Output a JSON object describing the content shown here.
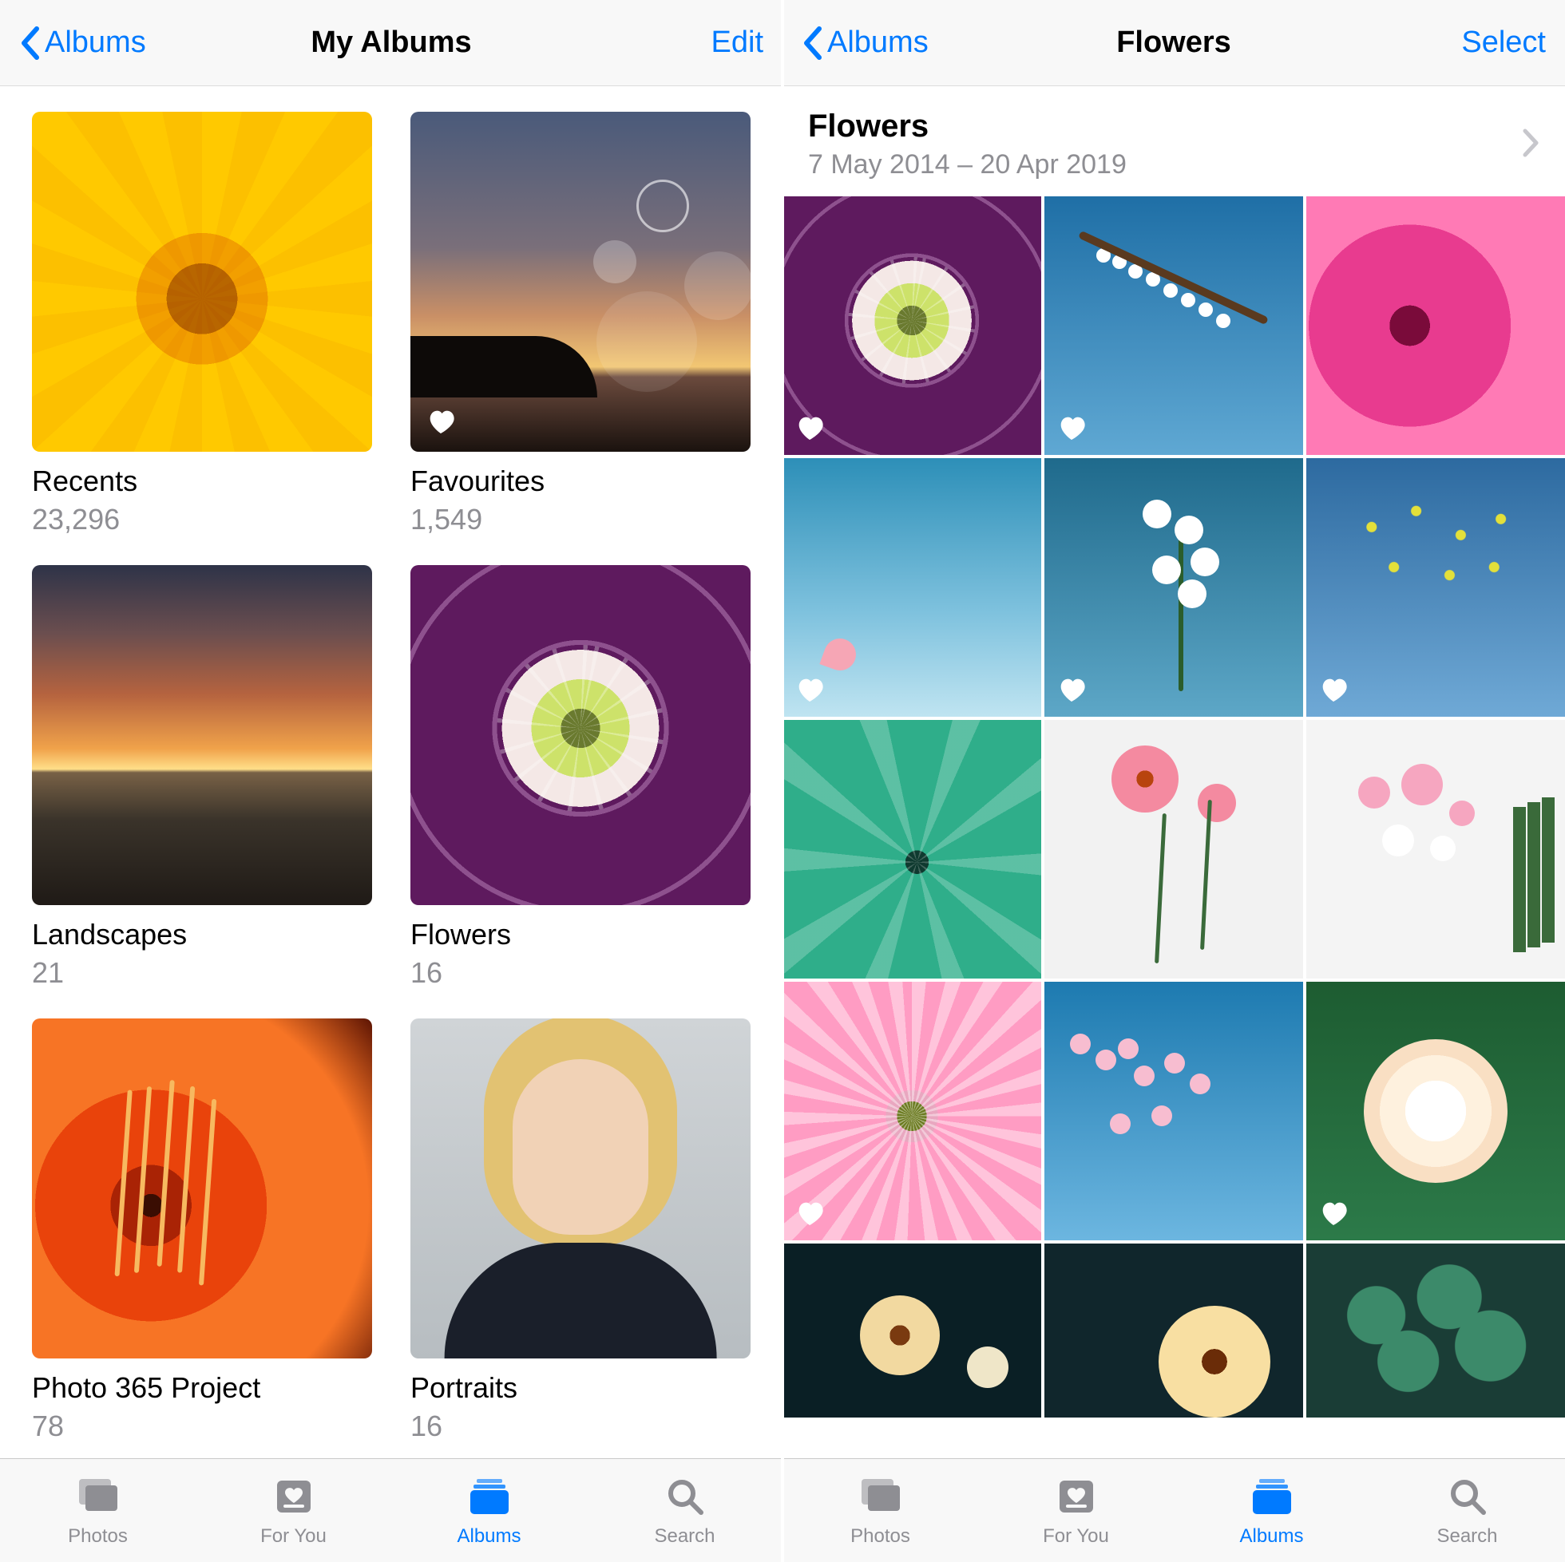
{
  "left": {
    "nav": {
      "back": "Albums",
      "title": "My Albums",
      "action": "Edit"
    },
    "albums": [
      {
        "name": "Recents",
        "count": "23,296",
        "art": "art-yellow",
        "favourite": false
      },
      {
        "name": "Favourites",
        "count": "1,549",
        "art": "art-bubbles",
        "favourite": true
      },
      {
        "name": "Landscapes",
        "count": "21",
        "art": "art-sunset",
        "favourite": false
      },
      {
        "name": "Flowers",
        "count": "16",
        "art": "art-hellebore",
        "favourite": false
      },
      {
        "name": "Photo 365 Project",
        "count": "78",
        "art": "art-orange",
        "favourite": false
      },
      {
        "name": "Portraits",
        "count": "16",
        "art": "art-portrait",
        "favourite": false
      }
    ],
    "peek": [
      "art-grey",
      "art-hedge"
    ]
  },
  "right": {
    "nav": {
      "back": "Albums",
      "title": "Flowers",
      "action": "Select"
    },
    "header": {
      "title": "Flowers",
      "subtitle": "7 May 2014 – 20 Apr 2019"
    },
    "photos": [
      {
        "art": "art-hellebore",
        "favourite": true
      },
      {
        "art": "p-blossom",
        "favourite": true
      },
      {
        "art": "p-pinkclose",
        "favourite": false
      },
      {
        "art": "p-skyblossom",
        "favourite": true
      },
      {
        "art": "p-orchid",
        "favourite": true
      },
      {
        "art": "p-yellowtiny",
        "favourite": true
      },
      {
        "art": "p-succulent",
        "favourite": false
      },
      {
        "art": "p-gerbera",
        "favourite": false
      },
      {
        "art": "p-bouquet",
        "favourite": false
      },
      {
        "art": "p-pinkdahlia",
        "favourite": true
      },
      {
        "art": "p-cherry",
        "favourite": false
      },
      {
        "art": "p-whiterose",
        "favourite": true
      },
      {
        "art": "p-darkflor1",
        "favourite": false
      },
      {
        "art": "p-darkflor2",
        "favourite": false
      },
      {
        "art": "p-clover",
        "favourite": false
      }
    ]
  },
  "tabs": [
    {
      "id": "photos",
      "label": "Photos"
    },
    {
      "id": "foryou",
      "label": "For You"
    },
    {
      "id": "albums",
      "label": "Albums"
    },
    {
      "id": "search",
      "label": "Search"
    }
  ],
  "active_tab": "albums"
}
